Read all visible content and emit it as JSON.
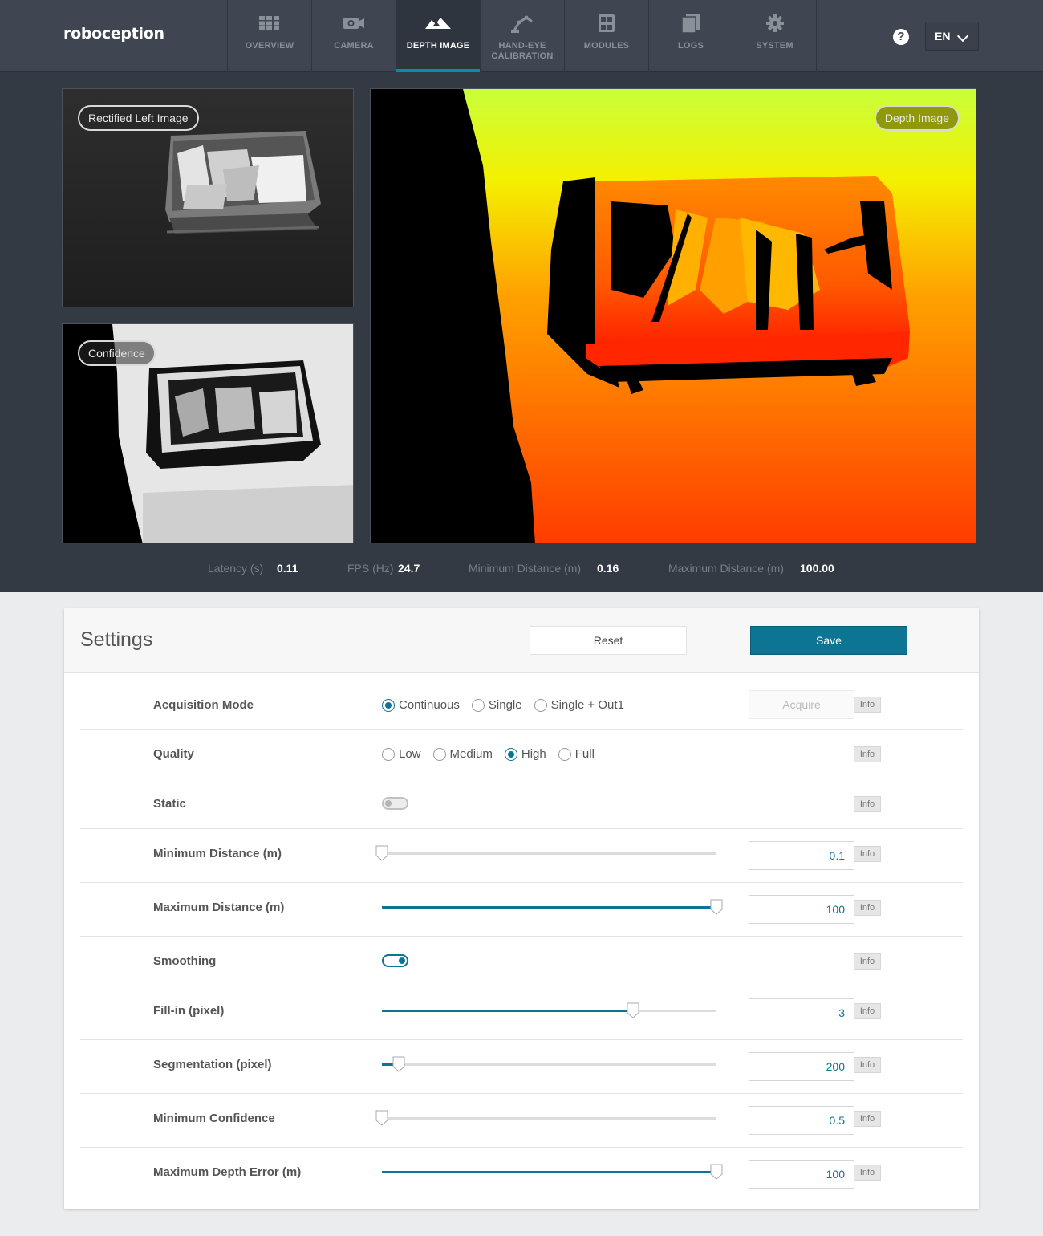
{
  "brand": "roboception",
  "nav": [
    {
      "label": "OVERVIEW",
      "icon": "grid-icon"
    },
    {
      "label": "CAMERA",
      "icon": "camera-icon"
    },
    {
      "label": "DEPTH IMAGE",
      "icon": "depth-image-icon",
      "active": true
    },
    {
      "label": "HAND-EYE CALIBRATION",
      "icon": "robot-arm-icon"
    },
    {
      "label": "MODULES",
      "icon": "modules-icon"
    },
    {
      "label": "LOGS",
      "icon": "document-icon"
    },
    {
      "label": "SYSTEM",
      "icon": "gear-icon"
    }
  ],
  "help_symbol": "?",
  "language": "EN",
  "images": {
    "left": "Rectified Left Image",
    "confidence": "Confidence",
    "depth": "Depth Image"
  },
  "stats": [
    {
      "label": "Latency (s)",
      "value": "0.11"
    },
    {
      "label": "FPS (Hz)",
      "value": "24.7"
    },
    {
      "label": "Minimum Distance (m)",
      "value": "0.16"
    },
    {
      "label": "Maximum Distance (m)",
      "value": "100.00"
    }
  ],
  "settings": {
    "title": "Settings",
    "reset_label": "Reset",
    "save_label": "Save",
    "info_label": "Info",
    "acquisition": {
      "label": "Acquisition Mode",
      "options": [
        "Continuous",
        "Single",
        "Single + Out1"
      ],
      "selected": "Continuous",
      "acquire_label": "Acquire"
    },
    "quality": {
      "label": "Quality",
      "options": [
        "Low",
        "Medium",
        "High",
        "Full"
      ],
      "selected": "High"
    },
    "static": {
      "label": "Static",
      "enabled": false
    },
    "min_distance": {
      "label": "Minimum Distance (m)",
      "value": "0.1",
      "fraction": 0.0
    },
    "max_distance": {
      "label": "Maximum Distance (m)",
      "value": "100",
      "fraction": 1.0
    },
    "smoothing": {
      "label": "Smoothing",
      "enabled": true
    },
    "fill_in": {
      "label": "Fill-in (pixel)",
      "value": "3",
      "fraction": 0.75
    },
    "segmentation": {
      "label": "Segmentation (pixel)",
      "value": "200",
      "fraction": 0.05
    },
    "min_confidence": {
      "label": "Minimum Confidence",
      "value": "0.5",
      "fraction": 0.0
    },
    "max_depth_error": {
      "label": "Maximum Depth Error (m)",
      "value": "100",
      "fraction": 1.0
    }
  },
  "colors": {
    "accent": "#0d7593",
    "nav_bg": "#3f4651",
    "dark_bg": "#343a44"
  }
}
